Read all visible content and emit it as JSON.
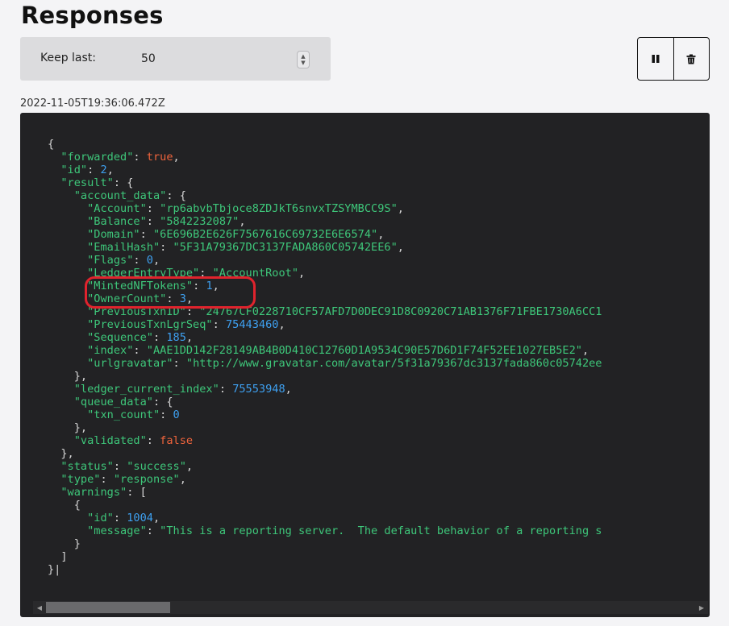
{
  "page": {
    "title": "Responses"
  },
  "controls": {
    "keep_last_label": "Keep last:",
    "keep_last_value": "50",
    "pause_icon": "pause-icon",
    "delete_icon": "trash-icon"
  },
  "response": {
    "timestamp": "2022-11-05T19:36:06.472Z",
    "lines": [
      [
        [
          "p",
          "{"
        ]
      ],
      [
        [
          "p",
          "  "
        ],
        [
          "k",
          "\"forwarded\""
        ],
        [
          "p",
          ": "
        ],
        [
          "b",
          "true"
        ],
        [
          "p",
          ","
        ]
      ],
      [
        [
          "p",
          "  "
        ],
        [
          "k",
          "\"id\""
        ],
        [
          "p",
          ": "
        ],
        [
          "n",
          "2"
        ],
        [
          "p",
          ","
        ]
      ],
      [
        [
          "p",
          "  "
        ],
        [
          "k",
          "\"result\""
        ],
        [
          "p",
          ": {"
        ]
      ],
      [
        [
          "p",
          "    "
        ],
        [
          "k",
          "\"account_data\""
        ],
        [
          "p",
          ": {"
        ]
      ],
      [
        [
          "p",
          "      "
        ],
        [
          "k",
          "\"Account\""
        ],
        [
          "p",
          ": "
        ],
        [
          "s",
          "\"rp6abvbTbjoce8ZDJkT6snvxTZSYMBCC9S\""
        ],
        [
          "p",
          ","
        ]
      ],
      [
        [
          "p",
          "      "
        ],
        [
          "k",
          "\"Balance\""
        ],
        [
          "p",
          ": "
        ],
        [
          "s",
          "\"5842232087\""
        ],
        [
          "p",
          ","
        ]
      ],
      [
        [
          "p",
          "      "
        ],
        [
          "k",
          "\"Domain\""
        ],
        [
          "p",
          ": "
        ],
        [
          "s",
          "\"6E696B2E626F7567616C69732E6E6574\""
        ],
        [
          "p",
          ","
        ]
      ],
      [
        [
          "p",
          "      "
        ],
        [
          "k",
          "\"EmailHash\""
        ],
        [
          "p",
          ": "
        ],
        [
          "s",
          "\"5F31A79367DC3137FADA860C05742EE6\""
        ],
        [
          "p",
          ","
        ]
      ],
      [
        [
          "p",
          "      "
        ],
        [
          "k",
          "\"Flags\""
        ],
        [
          "p",
          ": "
        ],
        [
          "n",
          "0"
        ],
        [
          "p",
          ","
        ]
      ],
      [
        [
          "p",
          "      "
        ],
        [
          "k",
          "\"LedgerEntryType\""
        ],
        [
          "p",
          ": "
        ],
        [
          "s",
          "\"AccountRoot\""
        ],
        [
          "p",
          ","
        ]
      ],
      [
        [
          "p",
          "      "
        ],
        [
          "k",
          "\"MintedNFTokens\""
        ],
        [
          "p",
          ": "
        ],
        [
          "n",
          "1"
        ],
        [
          "p",
          ","
        ]
      ],
      [
        [
          "p",
          "      "
        ],
        [
          "k",
          "\"OwnerCount\""
        ],
        [
          "p",
          ": "
        ],
        [
          "n",
          "3"
        ],
        [
          "p",
          ","
        ]
      ],
      [
        [
          "p",
          "      "
        ],
        [
          "k",
          "\"PreviousTxnID\""
        ],
        [
          "p",
          ": "
        ],
        [
          "s",
          "\"24767CF0228710CF57AFD7D0DEC91D8C0920C71AB1376F71FBE1730A6CC1"
        ]
      ],
      [
        [
          "p",
          "      "
        ],
        [
          "k",
          "\"PreviousTxnLgrSeq\""
        ],
        [
          "p",
          ": "
        ],
        [
          "n",
          "75443460"
        ],
        [
          "p",
          ","
        ]
      ],
      [
        [
          "p",
          "      "
        ],
        [
          "k",
          "\"Sequence\""
        ],
        [
          "p",
          ": "
        ],
        [
          "n",
          "185"
        ],
        [
          "p",
          ","
        ]
      ],
      [
        [
          "p",
          "      "
        ],
        [
          "k",
          "\"index\""
        ],
        [
          "p",
          ": "
        ],
        [
          "s",
          "\"AAE1DD142F28149AB4B0D410C12760D1A9534C90E57D6D1F74F52EE1027EB5E2\""
        ],
        [
          "p",
          ","
        ]
      ],
      [
        [
          "p",
          "      "
        ],
        [
          "k",
          "\"urlgravatar\""
        ],
        [
          "p",
          ": "
        ],
        [
          "s",
          "\"http://www.gravatar.com/avatar/5f31a79367dc3137fada860c05742ee"
        ]
      ],
      [
        [
          "p",
          "    },"
        ]
      ],
      [
        [
          "p",
          "    "
        ],
        [
          "k",
          "\"ledger_current_index\""
        ],
        [
          "p",
          ": "
        ],
        [
          "n",
          "75553948"
        ],
        [
          "p",
          ","
        ]
      ],
      [
        [
          "p",
          "    "
        ],
        [
          "k",
          "\"queue_data\""
        ],
        [
          "p",
          ": {"
        ]
      ],
      [
        [
          "p",
          "      "
        ],
        [
          "k",
          "\"txn_count\""
        ],
        [
          "p",
          ": "
        ],
        [
          "n",
          "0"
        ]
      ],
      [
        [
          "p",
          "    },"
        ]
      ],
      [
        [
          "p",
          "    "
        ],
        [
          "k",
          "\"validated\""
        ],
        [
          "p",
          ": "
        ],
        [
          "b",
          "false"
        ]
      ],
      [
        [
          "p",
          "  },"
        ]
      ],
      [
        [
          "p",
          "  "
        ],
        [
          "k",
          "\"status\""
        ],
        [
          "p",
          ": "
        ],
        [
          "s",
          "\"success\""
        ],
        [
          "p",
          ","
        ]
      ],
      [
        [
          "p",
          "  "
        ],
        [
          "k",
          "\"type\""
        ],
        [
          "p",
          ": "
        ],
        [
          "s",
          "\"response\""
        ],
        [
          "p",
          ","
        ]
      ],
      [
        [
          "p",
          "  "
        ],
        [
          "k",
          "\"warnings\""
        ],
        [
          "p",
          ": ["
        ]
      ],
      [
        [
          "p",
          "    {"
        ]
      ],
      [
        [
          "p",
          "      "
        ],
        [
          "k",
          "\"id\""
        ],
        [
          "p",
          ": "
        ],
        [
          "n",
          "1004"
        ],
        [
          "p",
          ","
        ]
      ],
      [
        [
          "p",
          "      "
        ],
        [
          "k",
          "\"message\""
        ],
        [
          "p",
          ": "
        ],
        [
          "s",
          "\"This is a reporting server.  The default behavior of a reporting s"
        ]
      ],
      [
        [
          "p",
          "    }"
        ]
      ],
      [
        [
          "p",
          "  ]"
        ]
      ],
      [
        [
          "p",
          "}|"
        ]
      ]
    ]
  },
  "annotation": {
    "color": "#e0232d"
  },
  "colors": {
    "key": "#3ec77a",
    "string": "#3ec77a",
    "number": "#3ea0f0",
    "boolean": "#f0643c",
    "panel_bg": "#222224"
  }
}
